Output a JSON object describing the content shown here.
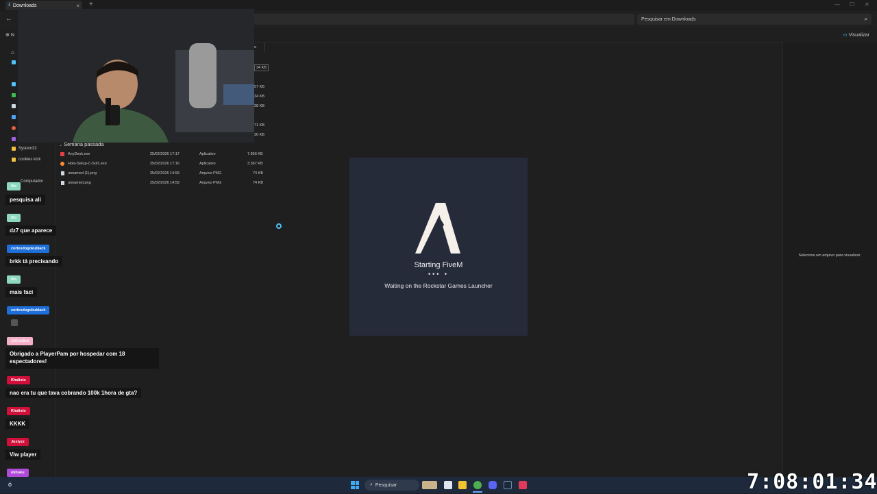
{
  "window": {
    "tab_title": "Downloads",
    "new_tab": "+",
    "close_tab": "×"
  },
  "toolbar": {
    "search_placeholder": "Pesquisar em Downloads",
    "new_label": "N",
    "view_label": "Visualizar"
  },
  "nav": {
    "items": [
      {
        "label": "System32",
        "icon": "folder-icon"
      },
      {
        "label": "cookies kick",
        "icon": "folder-icon"
      },
      {
        "label": "Computador",
        "icon": "computer-icon"
      }
    ]
  },
  "file_list": {
    "partial_column_header": "o",
    "partial_sizes": [
      "34 KB",
      "57 KB",
      "34 KB",
      "28 KB",
      "71 KB",
      "30 KB"
    ],
    "group_label": "Semana passada",
    "rows": [
      {
        "name": "AnyDesk.exe",
        "date": "25/02/2026 17:17",
        "type": "Aplicativo",
        "size": "7.856 KB",
        "icon_color": "#e04040"
      },
      {
        "name": "Hola-Setup-C-Sof1.exe",
        "date": "25/02/2026 17:16",
        "type": "Aplicativo",
        "size": "3.367 KB",
        "icon_color": "#ff8c30"
      },
      {
        "name": "unnamed (1).png",
        "date": "25/02/2026 14:59",
        "type": "Arquivo PNG",
        "size": "74 KB",
        "icon_color": "#cfd8e0"
      },
      {
        "name": "unnamed.png",
        "date": "25/02/2026 14:59",
        "type": "Arquivo PNG",
        "size": "74 KB",
        "icon_color": "#cfd8e0"
      }
    ]
  },
  "preview": {
    "message": "Selecione um arquivo para visualizar."
  },
  "splash": {
    "title": "Starting FiveM",
    "dots": "•••  •",
    "status": "Waiting on the Rockstar Games Launcher",
    "bg_color": "#262b3a"
  },
  "chat": [
    {
      "user": "lilo",
      "badge_color": "#8fd8c0",
      "text": "pesquisa ali"
    },
    {
      "user": "lilo",
      "badge_color": "#8fd8c0",
      "text": "dz7 que aparece"
    },
    {
      "user": "cortesdogokublack",
      "badge_color": "#1e6fd9",
      "text": "brkk tá precisando"
    },
    {
      "user": "lilo",
      "badge_color": "#8fd8c0",
      "text": "mais faci"
    },
    {
      "user": "cortesdogokublack",
      "badge_color": "#1e6fd9",
      "text": ""
    },
    {
      "user": "@KickBot",
      "badge_color": "#f4b0c8",
      "text": "Obrigado a PlayerPam por hospedar com 18 espectadores!"
    },
    {
      "user": "Khalixto",
      "badge_color": "#d0103a",
      "text": "nao era tu que tava cobrando 100k 1hora de gta?"
    },
    {
      "user": "Khalixto",
      "badge_color": "#d0103a",
      "text": "KKKK"
    },
    {
      "user": "Justyzz",
      "badge_color": "#d0103a",
      "text": "Viw player"
    },
    {
      "user": "mihoku",
      "badge_color": "#b04ad8",
      "text": ""
    }
  ],
  "taskbar": {
    "search_label": "Pesquisar",
    "start_icon": "windows-logo-icon",
    "bottom_left_text": "ó"
  },
  "overlay_clock": "7:08:01:34"
}
